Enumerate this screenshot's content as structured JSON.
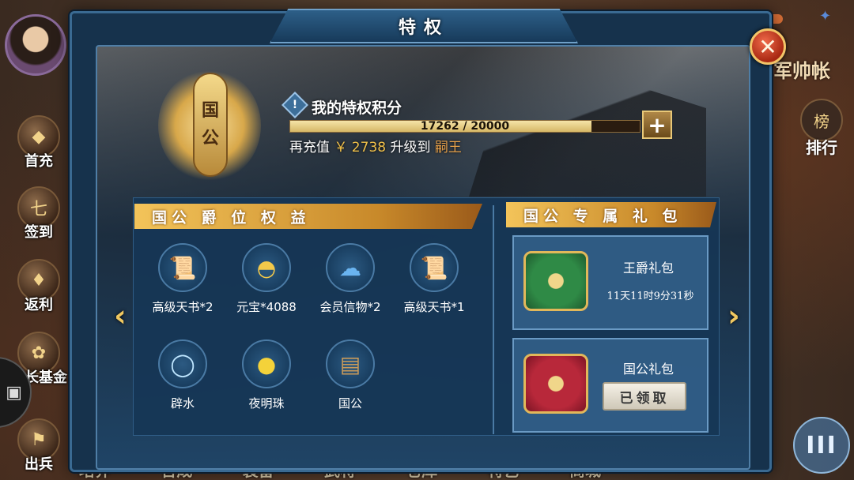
{
  "dialog": {
    "title": "特权"
  },
  "rank": {
    "char1": "国",
    "char2": "公"
  },
  "points": {
    "title": "我的特权积分",
    "current": 17262,
    "max": 20000,
    "progress_text": "17262 / 20000",
    "fraction": 0.863
  },
  "recharge": {
    "prefix": "再充值",
    "amount": "￥ 2738",
    "middle": "升级到",
    "next_rank": "嗣王"
  },
  "benefits": {
    "title": "国公 爵 位 权 益",
    "items": [
      {
        "label": "高级天书*2",
        "icon": "scroll-icon"
      },
      {
        "label": "元宝*4088",
        "icon": "gold-ingot-icon"
      },
      {
        "label": "会员信物*2",
        "icon": "cloud-token-icon"
      },
      {
        "label": "高级天书*1",
        "icon": "scroll-icon"
      },
      {
        "label": "辟水",
        "icon": "water-ring-icon"
      },
      {
        "label": "夜明珠",
        "icon": "pearl-icon"
      },
      {
        "label": "国公",
        "icon": "book-icon"
      }
    ]
  },
  "gifts": {
    "title": "国公 专 属 礼 包",
    "items": [
      {
        "name": "王爵礼包",
        "timer": "11天11时9分31秒",
        "icon": "green-chest-icon"
      },
      {
        "name": "国公礼包",
        "button": "已领取",
        "icon": "red-chest-icon"
      }
    ]
  },
  "side_menu": [
    {
      "label": "首充",
      "icon": "first-charge-icon"
    },
    {
      "label": "签到",
      "icon": "sign-in-icon"
    },
    {
      "label": "返利",
      "icon": "rebate-icon"
    },
    {
      "label": "成长基金",
      "icon": "growth-fund-icon"
    },
    {
      "label": "出兵",
      "icon": "dispatch-icon"
    }
  ],
  "right": {
    "partial_title": "军帅帐",
    "rank_label": "排行",
    "menu_glyph": "III"
  },
  "bottom_nav": [
    "培养",
    "合成",
    "装备",
    "武将",
    "仓库",
    "特艺",
    "商城"
  ],
  "colors": {
    "gold": "#f0c04a",
    "panel": "#16324c",
    "accent": "#e8a24a"
  }
}
